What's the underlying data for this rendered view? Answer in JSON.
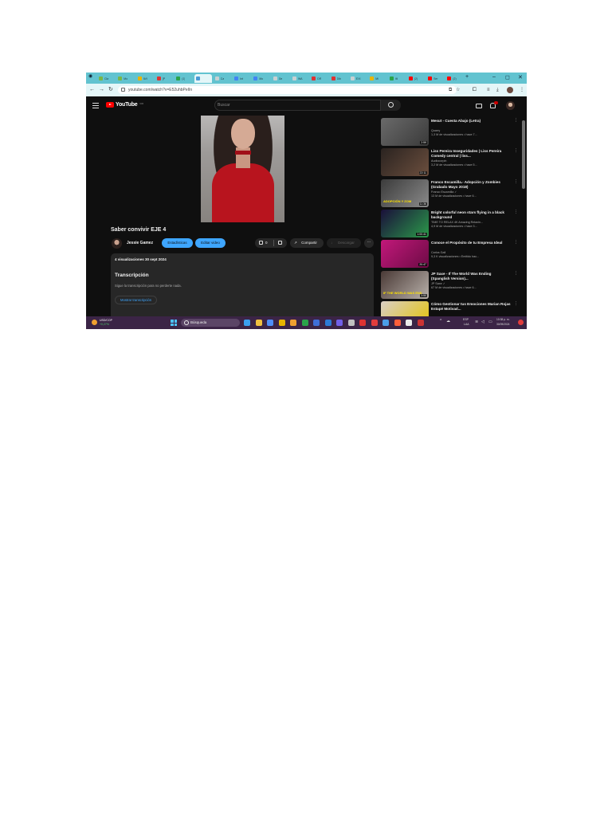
{
  "colors": {
    "accent": "#3ea6ff",
    "brand": "#ff0000",
    "page_bg": "#0f0f0f",
    "tab_strip": "#62c3d0",
    "taskbar": "#3b2446"
  },
  "browser": {
    "tabs": [
      {
        "label": "Cla",
        "color": "#7ab648"
      },
      {
        "label": "Mo",
        "color": "#7ab648"
      },
      {
        "label": "AVI",
        "color": "#e8b400"
      },
      {
        "label": "[P",
        "color": "#d33"
      },
      {
        "label": "(1)",
        "color": "#2aa44a"
      },
      {
        "label": "",
        "color": "#4a9bd6",
        "active": true
      },
      {
        "label": "Ca",
        "color": "#c7d0d2"
      },
      {
        "label": "Int",
        "color": "#4285f4"
      },
      {
        "label": "Mo",
        "color": "#4285f4"
      },
      {
        "label": "Ge",
        "color": "#c7d0d2"
      },
      {
        "label": "WA",
        "color": "#c7d0d2"
      },
      {
        "label": "DR",
        "color": "#d33"
      },
      {
        "label": "Dib",
        "color": "#d33"
      },
      {
        "label": "EXI",
        "color": "#c7d0d2"
      },
      {
        "label": "Mi",
        "color": "#e8b400"
      },
      {
        "label": "Mi",
        "color": "#2aa44a"
      },
      {
        "label": "(2)",
        "color": "#ff0000"
      },
      {
        "label": "Ser",
        "color": "#ff0000"
      },
      {
        "label": "(2)",
        "color": "#ff0000"
      }
    ],
    "url": "youtube.com/watch?v=E52uhbPeIIn",
    "window_controls": {
      "minimize": "–",
      "maximize": "◻",
      "close": "✕"
    },
    "new_tab": "+"
  },
  "youtube": {
    "logo_text": "YouTube",
    "logo_superscript": "CO",
    "search_placeholder": "Buscar",
    "video": {
      "title": "Saber convivir EJE 4",
      "channel": "Jessie Gamez",
      "stats_button": "Estadísticas",
      "edit_button": "Editar video",
      "likes": "0",
      "share": "Compartir",
      "download": "Descargar",
      "more": "···",
      "views_date": "4 visualizaciones  30 sept 2024",
      "transcript_title": "Transcripción",
      "transcript_sub": "Sigue la transcripción para no perderte nada.",
      "transcript_button": "Mostrar transcripción"
    },
    "recommendations": [
      {
        "title": "Mesut - Cuesta Abajo (Letra)",
        "channel": "Quarry",
        "views": "1,3 M de visualizaciones  • hace 7...",
        "duration": "2:59",
        "thumb_colors": [
          "#6a6a6a",
          "#3a3a3a"
        ],
        "thumb_text": ""
      },
      {
        "title": "Liss Pereira Inseguridades | Liss Pereira Comedy central | liss...",
        "channel": "Audiocorpin",
        "views": "3,2 M de visualizaciones  • hace 5...",
        "duration": "22:11",
        "thumb_colors": [
          "#2a2320",
          "#6c4f3e"
        ],
        "thumb_text": ""
      },
      {
        "title": "Franco Escamilla.- Adopción y Zombies (Grabado Mayo 2018)",
        "channel": "Franco Escamilla ✓",
        "views": "13 M de visualizaciones  • hace 6...",
        "duration": "11:36",
        "thumb_colors": [
          "#3b3b3b",
          "#8a8a8a"
        ],
        "thumb_text": "ADOPCIÓN Y ZOM"
      },
      {
        "title": "Bright colorful neon stars flying in a black background",
        "channel": "TIME TO RELAX 4K Amazing Relaxin...",
        "views": "4,9 M de visualizaciones  • hace 3...",
        "duration": "1:00:41",
        "thumb_colors": [
          "#1a0f3a",
          "#2b9a4a"
        ],
        "thumb_text": ""
      },
      {
        "title": "Conoce el Propósito de tu Empresa Ideal",
        "channel": "Carlos Gall",
        "views": "9,3 K visualizaciones  • Emitido hac...",
        "duration": "20:47",
        "thumb_colors": [
          "#c2187a",
          "#6d0b45"
        ],
        "thumb_text": ""
      },
      {
        "title": "JP Saxe - If The World Was Ending (Spanglish Version)...",
        "channel": "JP Saxe ✓",
        "views": "67 M de visualizaciones  • hace 6...",
        "duration": "3:50",
        "thumb_colors": [
          "#4a3a36",
          "#b8b0aa"
        ],
        "thumb_text": "IF THE WORLD WAS END"
      },
      {
        "title": "Cómo Gestionar tus Emociones Marian Rojas Estapé Motivad...",
        "channel": "",
        "views": "",
        "duration": "",
        "thumb_colors": [
          "#d9cfc7",
          "#e4c300"
        ],
        "thumb_text": "Tus Emociones"
      }
    ]
  },
  "taskbar": {
    "ticker_name": "USD/COP",
    "ticker_change": "+0,27%",
    "search_label": "Búsqueda",
    "lang": "ESP",
    "lang_sub": "LAA",
    "time": "10:38 p. m.",
    "date": "30/09/2024",
    "app_icon_colors": [
      "#3aa0f0",
      "#f0c040",
      "#4e8ef7",
      "#e8b400",
      "#f0a030",
      "#2aa44a",
      "#3f6ed8",
      "#2b7ad6",
      "#7160e8",
      "#c0c0c0",
      "#d33",
      "#e23c3c",
      "#4b9de8",
      "#ff5e3a",
      "#eaeaea",
      "#c33"
    ]
  }
}
